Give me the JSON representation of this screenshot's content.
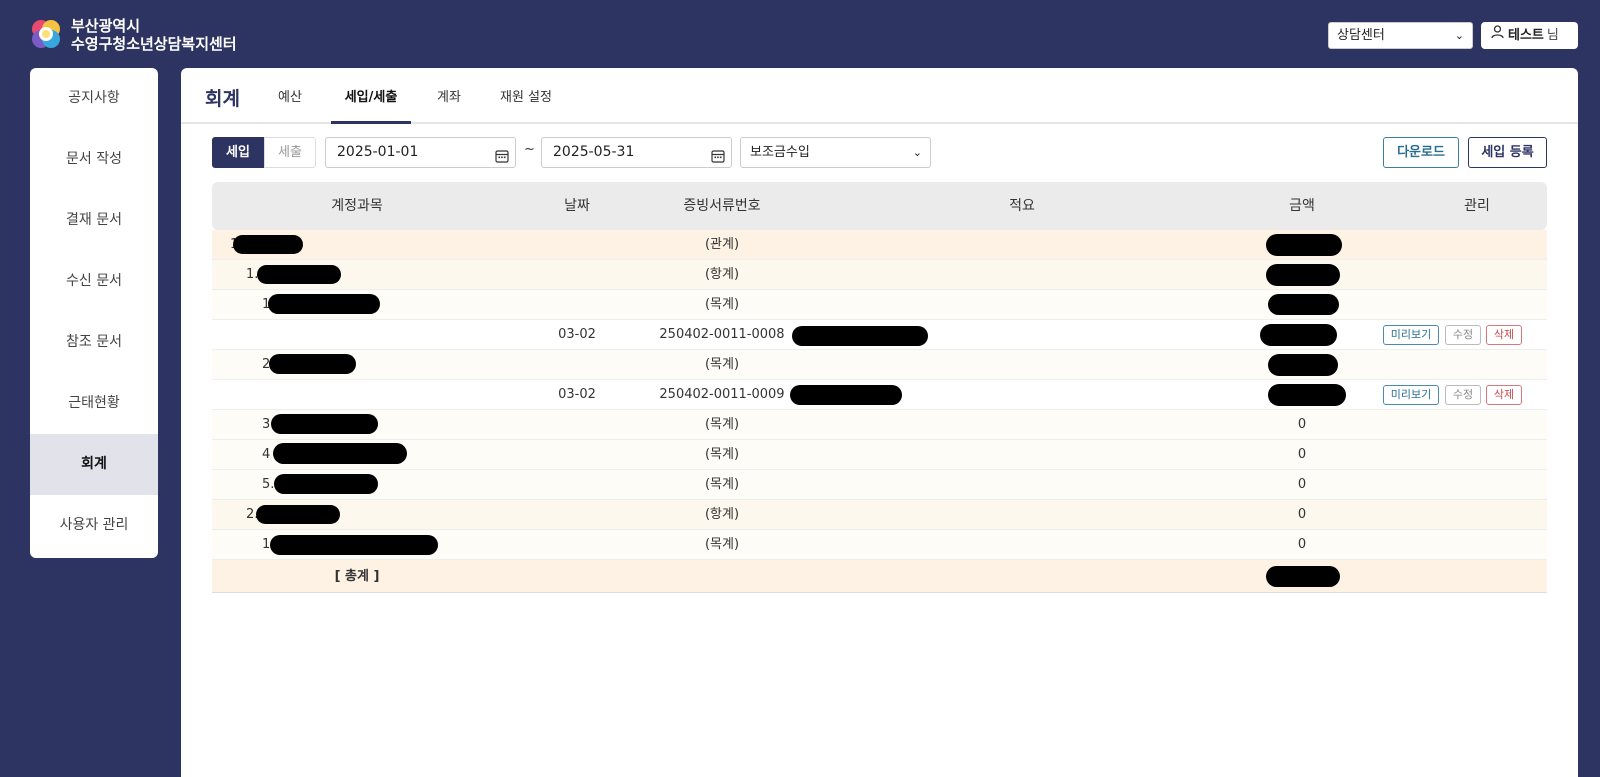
{
  "header": {
    "org_line1": "부산광역시",
    "org_line2": "수영구청소년상담복지센터",
    "center_select": "상담센터",
    "user_name": "테스트",
    "user_suffix": "님"
  },
  "sidebar": {
    "items": [
      {
        "label": "공지사항"
      },
      {
        "label": "문서 작성"
      },
      {
        "label": "결재 문서"
      },
      {
        "label": "수신 문서"
      },
      {
        "label": "참조 문서"
      },
      {
        "label": "근태현황"
      },
      {
        "label": "회계"
      },
      {
        "label": "사용자 관리"
      }
    ],
    "active_index": 6
  },
  "tabs": {
    "title": "회계",
    "items": [
      {
        "label": "예산"
      },
      {
        "label": "세입/세출"
      },
      {
        "label": "계좌"
      },
      {
        "label": "재원 설정"
      }
    ],
    "active_index": 1
  },
  "filters": {
    "toggle_income": "세입",
    "toggle_expense": "세출",
    "start_date": "2025-01-01",
    "separator": "~",
    "end_date": "2025-05-31",
    "type_select": "보조금수입",
    "download_label": "다운로드",
    "register_label": "세입 등록"
  },
  "table": {
    "headers": {
      "account": "계정과목",
      "date": "날짜",
      "proof_no": "증빙서류번호",
      "desc": "적요",
      "amount": "금액",
      "manage": "관리"
    },
    "rows": [
      {
        "prefix": "1",
        "date": "",
        "proof": "(관계)",
        "amount": ""
      },
      {
        "prefix": "1.",
        "date": "",
        "proof": "(항계)",
        "amount": ""
      },
      {
        "prefix": "1",
        "date": "",
        "proof": "(목계)",
        "amount": ""
      },
      {
        "prefix": "",
        "date": "03-02",
        "proof": "250402-0011-0008",
        "amount": ""
      },
      {
        "prefix": "2",
        "date": "",
        "proof": "(목계)",
        "amount": ""
      },
      {
        "prefix": "",
        "date": "03-02",
        "proof": "250402-0011-0009",
        "amount": ""
      },
      {
        "prefix": "3",
        "date": "",
        "proof": "(목계)",
        "amount": "0"
      },
      {
        "prefix": "4",
        "date": "",
        "proof": "(목계)",
        "amount": "0"
      },
      {
        "prefix": "5.",
        "date": "",
        "proof": "(목계)",
        "amount": "0"
      },
      {
        "prefix": "2.",
        "date": "",
        "proof": "(항계)",
        "amount": "0"
      },
      {
        "prefix": "1",
        "date": "",
        "proof": "(목계)",
        "amount": "0"
      }
    ],
    "total_label": "[ 총계 ]",
    "actions": {
      "preview": "미리보기",
      "edit": "수정",
      "delete": "삭제"
    }
  },
  "colors": {
    "navy": "#2d3461",
    "row_gwan": "#fdf2e3",
    "row_hang": "#fdf8ee",
    "row_mok": "#fefcf6"
  }
}
